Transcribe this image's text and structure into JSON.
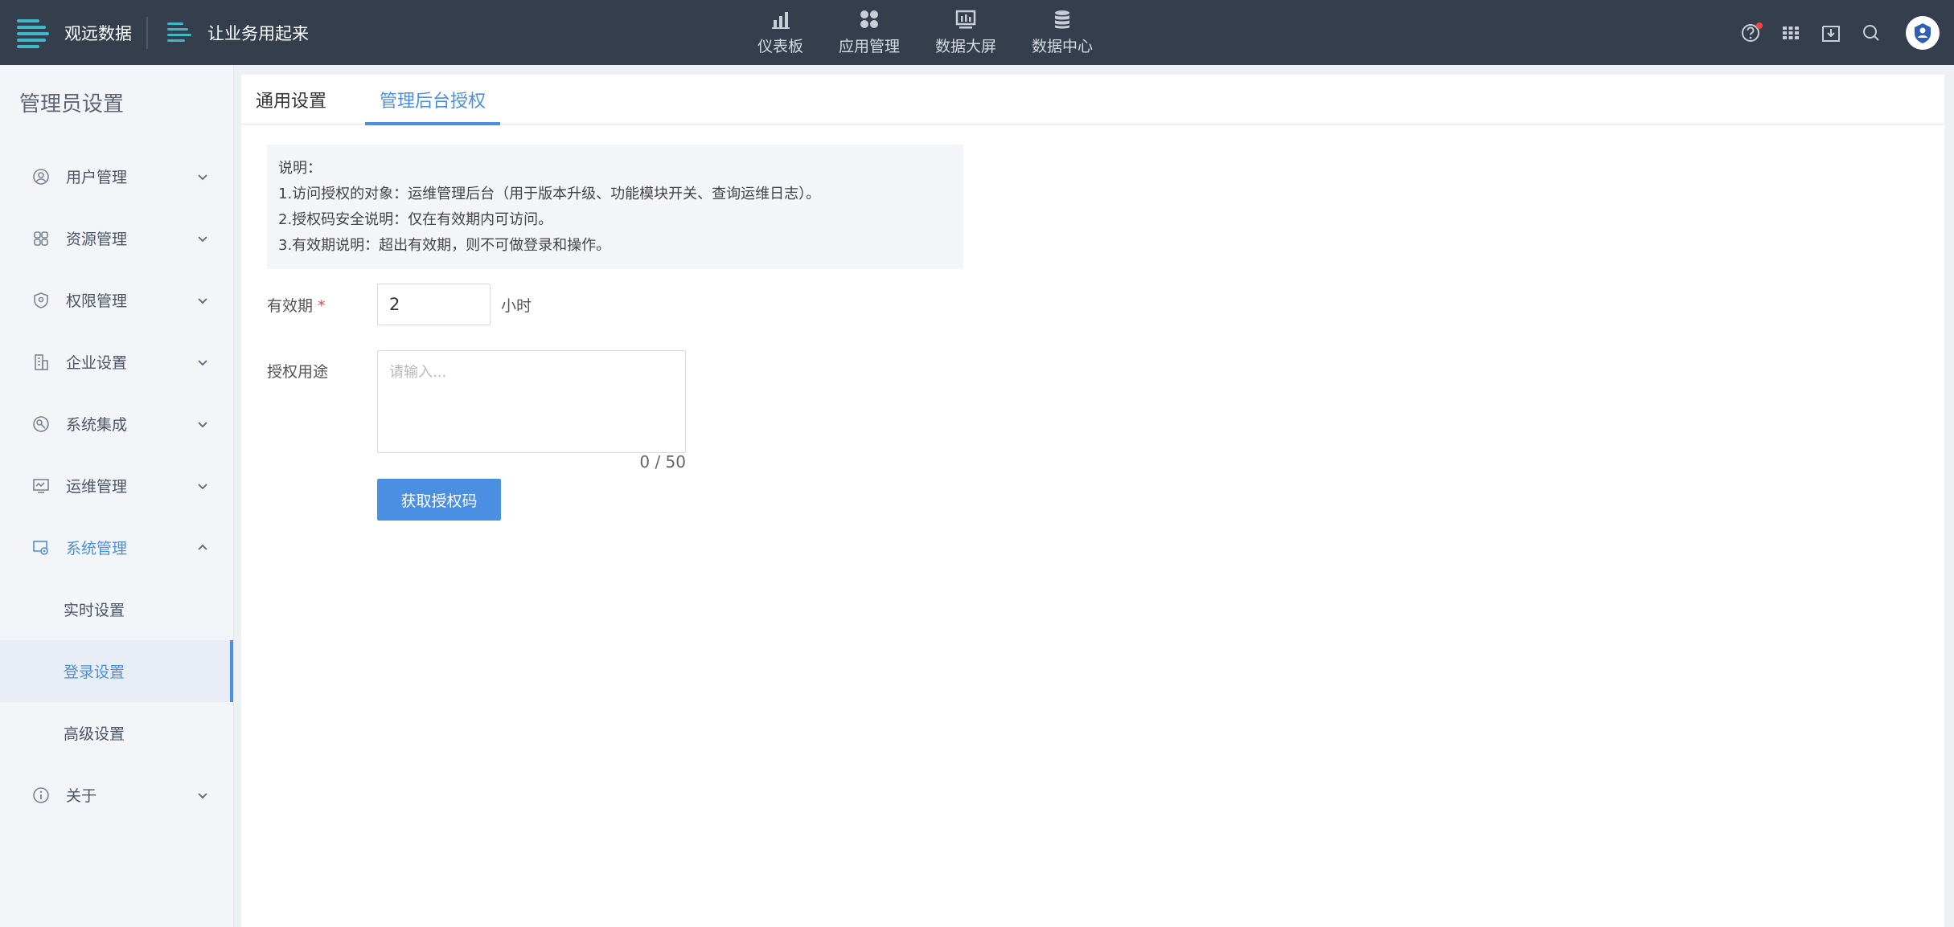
{
  "topbar": {
    "brand_name": "观远数据",
    "app_name": "让业务用起来",
    "nav": [
      {
        "label": "仪表板",
        "icon": "bar-chart-icon"
      },
      {
        "label": "应用管理",
        "icon": "apps-icon"
      },
      {
        "label": "数据大屏",
        "icon": "big-screen-icon"
      },
      {
        "label": "数据中心",
        "icon": "database-icon"
      }
    ],
    "tools": [
      "help-icon",
      "grid-menu-icon",
      "download-inbox-icon",
      "search-icon"
    ],
    "colors": {
      "bg": "#353e4d",
      "notification_dot": "#f5483b"
    }
  },
  "sidebar": {
    "title": "管理员设置",
    "items": [
      {
        "label": "用户管理",
        "icon": "user-icon"
      },
      {
        "label": "资源管理",
        "icon": "resource-icon"
      },
      {
        "label": "权限管理",
        "icon": "shield-icon"
      },
      {
        "label": "企业设置",
        "icon": "building-icon"
      },
      {
        "label": "系统集成",
        "icon": "integration-icon"
      },
      {
        "label": "运维管理",
        "icon": "monitor-icon"
      },
      {
        "label": "系统管理",
        "icon": "system-settings-icon"
      }
    ],
    "sub_items": [
      "实时设置",
      "登录设置",
      "高级设置"
    ],
    "about": {
      "label": "关于",
      "icon": "info-icon"
    }
  },
  "main": {
    "tabs": [
      "通用设置",
      "管理后台授权"
    ],
    "notice": {
      "title": "说明：",
      "lines": [
        "1.访问授权的对象：运维管理后台（用于版本升级、功能模块开关、查询运维日志）。",
        "2.授权码安全说明：仅在有效期内可访问。",
        "3.有效期说明：超出有效期，则不可做登录和操作。"
      ]
    },
    "validity": {
      "label": "有效期",
      "required_mark": "*",
      "value": "2",
      "unit": "小时"
    },
    "purpose": {
      "label": "授权用途",
      "placeholder": "请输入...",
      "counter": "0 / 50"
    },
    "submit_label": "获取授权码",
    "accent": "#4a8fe2"
  }
}
